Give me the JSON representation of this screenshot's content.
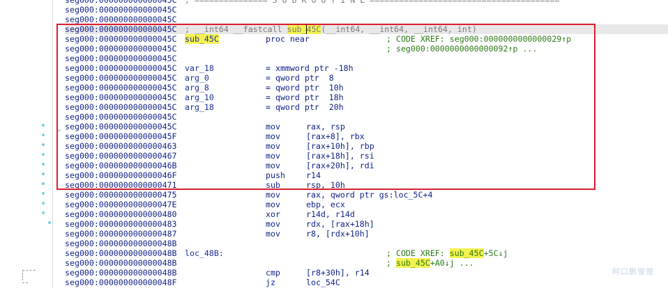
{
  "watermark": "阿口鹏慢慢",
  "highlight_color": "#f4f250",
  "annotation_color": "#dc1c2e",
  "lines": [
    {
      "addr": "seg000:000000000000045C",
      "header": "; =============== S U B R O U T I N E ======================================="
    },
    {
      "addr": "seg000:000000000000045C"
    },
    {
      "addr": "seg000:000000000000045C"
    },
    {
      "addr": "seg000:000000000000045C",
      "current": true,
      "sig": {
        "pre": "; __int64 __fastcall ",
        "hl": "sub_45C",
        "post": "(__int64, __int64, __int64, int)"
      }
    },
    {
      "addr": "seg000:000000000000045C",
      "label": "sub_45C",
      "label_hl": true,
      "mnem": "proc near",
      "comment": "; CODE XREF: seg000:0000000000000029↑p"
    },
    {
      "addr": "seg000:000000000000045C",
      "comment": "; seg000:0000000000000092↑p ..."
    },
    {
      "addr": "seg000:000000000000045C"
    },
    {
      "addr": "seg000:000000000000045C",
      "label": "var_18",
      "mnem": "= xmmword ptr -18h"
    },
    {
      "addr": "seg000:000000000000045C",
      "label": "arg_0",
      "mnem": "= qword ptr  8"
    },
    {
      "addr": "seg000:000000000000045C",
      "label": "arg_8",
      "mnem": "= qword ptr  10h"
    },
    {
      "addr": "seg000:000000000000045C",
      "label": "arg_10",
      "mnem": "= qword ptr  18h"
    },
    {
      "addr": "seg000:000000000000045C",
      "label": "arg_18",
      "mnem": "= qword ptr  20h"
    },
    {
      "addr": "seg000:000000000000045C"
    },
    {
      "addr": "seg000:000000000000045C",
      "mnem": "mov",
      "ops": "rax, rsp"
    },
    {
      "addr": "seg000:000000000000045F",
      "mnem": "mov",
      "ops": "[rax+8], rbx"
    },
    {
      "addr": "seg000:0000000000000463",
      "mnem": "mov",
      "ops": "[rax+10h], rbp"
    },
    {
      "addr": "seg000:0000000000000467",
      "mnem": "mov",
      "ops": "[rax+18h], rsi"
    },
    {
      "addr": "seg000:000000000000046B",
      "mnem": "mov",
      "ops": "[rax+20h], rdi"
    },
    {
      "addr": "seg000:000000000000046F",
      "mnem": "push",
      "ops": "r14"
    },
    {
      "addr": "seg000:0000000000000471",
      "mnem": "sub",
      "ops": "rsp, 10h"
    },
    {
      "addr": "seg000:0000000000000475",
      "mnem": "mov",
      "ops": "rax, qword ptr gs:loc_5C+4"
    },
    {
      "addr": "seg000:000000000000047E",
      "mnem": "mov",
      "ops": "ebp, ecx"
    },
    {
      "addr": "seg000:0000000000000480",
      "mnem": "xor",
      "ops": "r14d, r14d"
    },
    {
      "addr": "seg000:0000000000000483",
      "mnem": "mov",
      "ops": "rdx, [rax+18h]"
    },
    {
      "addr": "seg000:0000000000000487",
      "mnem": "mov",
      "ops": "r8, [rdx+10h]"
    },
    {
      "addr": "seg000:000000000000048B"
    },
    {
      "addr": "seg000:000000000000048B",
      "label": "loc_48B:",
      "xref": {
        "pre": "; CODE XREF: ",
        "hl": "sub_45C",
        "post": "+5C↓j"
      }
    },
    {
      "addr": "seg000:000000000000048B",
      "xref": {
        "pre": "; ",
        "hl": "sub_45C",
        "post": "+A0↓j ..."
      }
    },
    {
      "addr": "seg000:000000000000048B",
      "mnem": "cmp",
      "ops": "[r8+30h], r14"
    },
    {
      "addr": "seg000:000000000000048F",
      "mnem": "jz",
      "ops": "loc_54C"
    }
  ]
}
